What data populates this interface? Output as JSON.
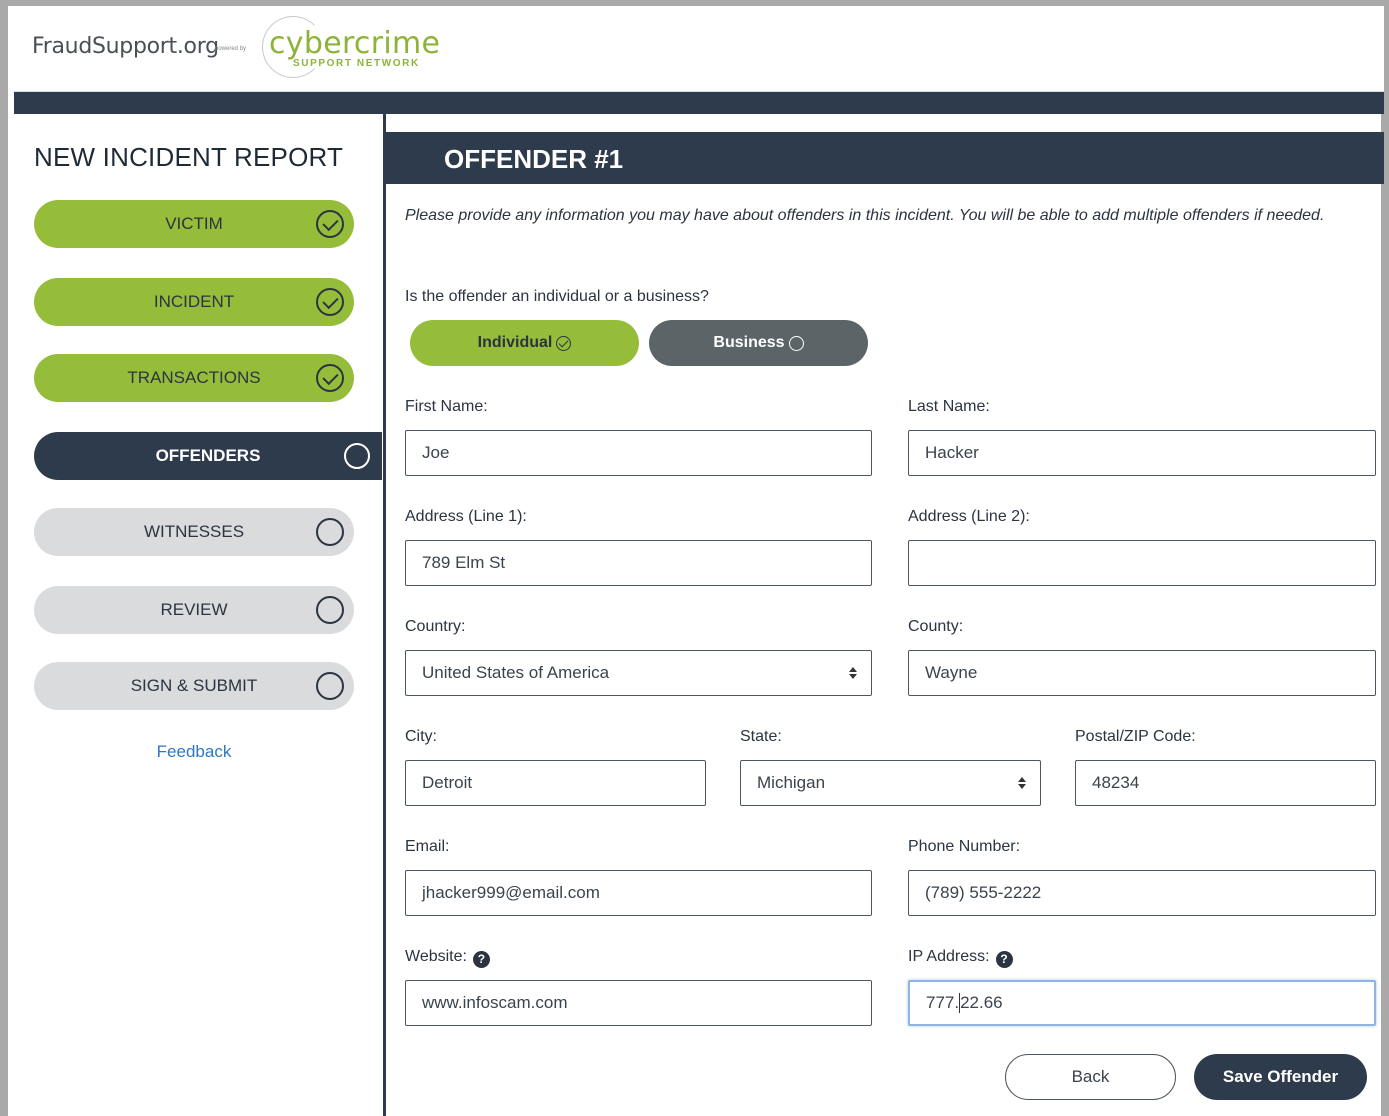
{
  "header": {
    "brand": "FraudSupport.org",
    "powered_by": "powered by",
    "partner_name": "cybercrime",
    "partner_sub": "SUPPORT NETWORK"
  },
  "sidebar": {
    "title": "NEW INCIDENT REPORT",
    "steps": [
      {
        "label": "VICTIM",
        "state": "done"
      },
      {
        "label": "INCIDENT",
        "state": "done"
      },
      {
        "label": "TRANSACTIONS",
        "state": "done"
      },
      {
        "label": "OFFENDERS",
        "state": "active"
      },
      {
        "label": "WITNESSES",
        "state": "todo"
      },
      {
        "label": "REVIEW",
        "state": "todo"
      },
      {
        "label": "SIGN & SUBMIT",
        "state": "todo"
      }
    ],
    "feedback": "Feedback"
  },
  "main": {
    "title": "OFFENDER #1",
    "intro": "Please provide any information you may have about offenders in this incident. You will be able to add multiple offenders if needed.",
    "question": "Is the offender an individual or a business?",
    "type_options": {
      "individual": "Individual",
      "business": "Business",
      "selected": "individual"
    },
    "fields": {
      "first_name": {
        "label": "First Name:",
        "value": "Joe"
      },
      "last_name": {
        "label": "Last Name:",
        "value": "Hacker"
      },
      "address1": {
        "label": "Address (Line 1):",
        "value": "789 Elm St"
      },
      "address2": {
        "label": "Address (Line 2):",
        "value": ""
      },
      "country": {
        "label": "Country:",
        "value": "United States of America"
      },
      "county": {
        "label": "County:",
        "value": "Wayne"
      },
      "city": {
        "label": "City:",
        "value": "Detroit"
      },
      "state": {
        "label": "State:",
        "value": "Michigan"
      },
      "zip": {
        "label": "Postal/ZIP Code:",
        "value": "48234"
      },
      "email": {
        "label": "Email:",
        "value": "jhacker999@email.com"
      },
      "phone": {
        "label": "Phone Number:",
        "value": "(789) 555-2222"
      },
      "website": {
        "label": "Website:",
        "value": "www.infoscam.com"
      },
      "ip": {
        "label": "IP Address:",
        "value_before_caret": "777.",
        "value_after_caret": "22.66"
      }
    },
    "buttons": {
      "back": "Back",
      "save": "Save Offender"
    }
  },
  "colors": {
    "green": "#95bd3a",
    "navy": "#2e3b4c",
    "gray": "#d9dbdc",
    "link": "#2f78c4"
  }
}
